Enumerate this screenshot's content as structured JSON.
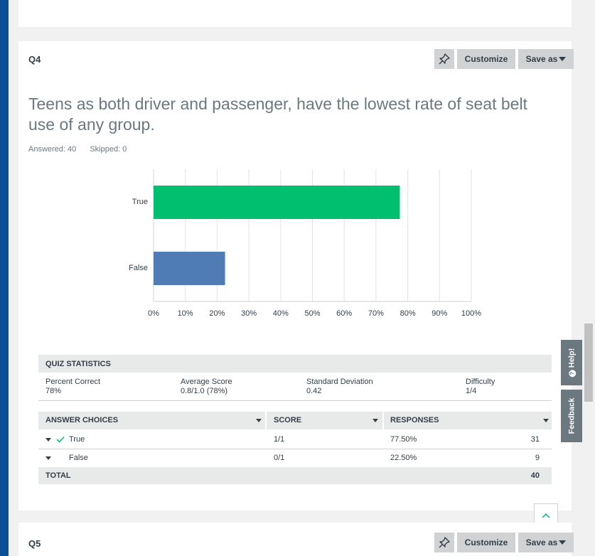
{
  "q4": {
    "number": "Q4",
    "customize_label": "Customize",
    "save_as_label": "Save as",
    "title": "Teens as both driver and passenger, have the lowest rate of seat belt use of any group.",
    "answered": "Answered: 40",
    "skipped": "Skipped: 0"
  },
  "chart_data": {
    "type": "bar",
    "orientation": "horizontal",
    "categories": [
      "True",
      "False"
    ],
    "values": [
      77.5,
      22.5
    ],
    "colors": [
      "#00bf6f",
      "#507cb6"
    ],
    "xlim": [
      0,
      100
    ],
    "xticks": [
      "0%",
      "10%",
      "20%",
      "30%",
      "40%",
      "50%",
      "60%",
      "70%",
      "80%",
      "90%",
      "100%"
    ],
    "grid": true
  },
  "quiz_statistics": {
    "header": "QUIZ STATISTICS",
    "items": [
      {
        "label": "Percent Correct",
        "value": "78%"
      },
      {
        "label": "Average Score",
        "value": "0.8/1.0 (78%)"
      },
      {
        "label": "Standard Deviation",
        "value": "0.42"
      },
      {
        "label": "Difficulty",
        "value": "1/4"
      }
    ]
  },
  "table": {
    "headers": [
      "ANSWER CHOICES",
      "SCORE",
      "RESPONSES"
    ],
    "rows": [
      {
        "choice": "True",
        "score": "1/1",
        "percent": "77.50%",
        "count": "31",
        "correct": true
      },
      {
        "choice": "False",
        "score": "0/1",
        "percent": "22.50%",
        "count": "9",
        "correct": false
      }
    ],
    "total_label": "TOTAL",
    "total_count": "40"
  },
  "q5": {
    "number": "Q5",
    "customize_label": "Customize",
    "save_as_label": "Save as"
  },
  "side": {
    "help_label": "Help!",
    "feedback_label": "Feedback"
  }
}
